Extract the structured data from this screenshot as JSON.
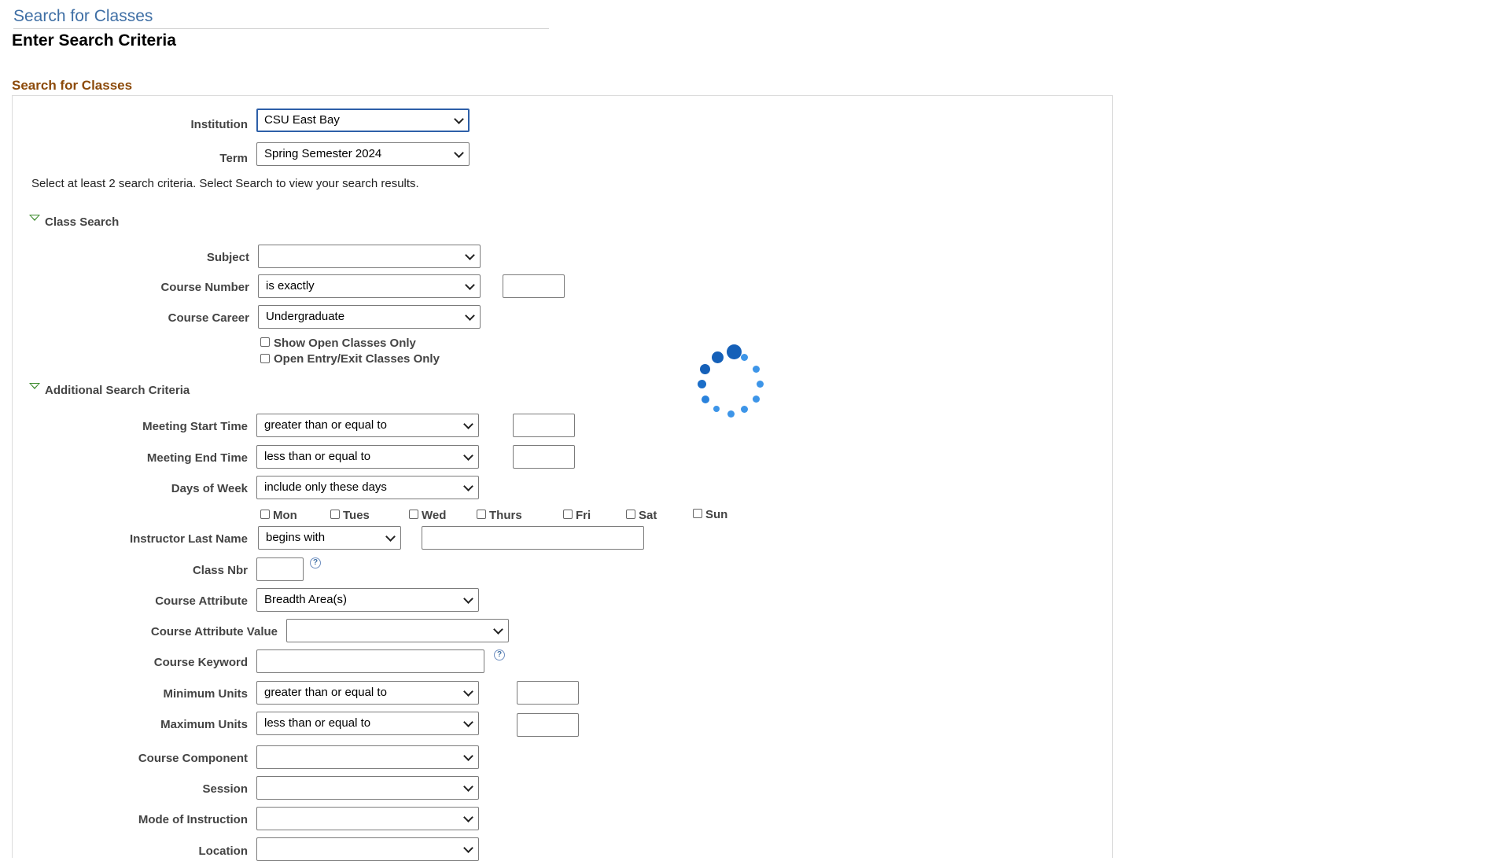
{
  "page": {
    "header": "Search for Classes",
    "subtitle": "Enter Search Criteria",
    "group_title": "Search for Classes"
  },
  "institution": {
    "label": "Institution",
    "value": "CSU East Bay"
  },
  "term": {
    "label": "Term",
    "value": "Spring Semester 2024"
  },
  "instructions": "Select at least 2 search criteria. Select Search to view your search results.",
  "class_search": {
    "title": "Class Search",
    "subject": {
      "label": "Subject",
      "value": ""
    },
    "course_number": {
      "label": "Course Number",
      "operator": "is exactly",
      "value": ""
    },
    "course_career": {
      "label": "Course Career",
      "value": "Undergraduate"
    },
    "open_classes_only": {
      "label": "Show Open Classes Only",
      "checked": false
    },
    "open_entry_exit_only": {
      "label": "Open Entry/Exit Classes Only",
      "checked": false
    }
  },
  "additional": {
    "title": "Additional Search Criteria",
    "meeting_start": {
      "label": "Meeting Start Time",
      "operator": "greater than or equal to",
      "value": ""
    },
    "meeting_end": {
      "label": "Meeting End Time",
      "operator": "less than or equal to",
      "value": ""
    },
    "days_of_week": {
      "label": "Days of Week",
      "operator": "include only these days",
      "days": [
        {
          "label": "Mon",
          "checked": false
        },
        {
          "label": "Tues",
          "checked": false
        },
        {
          "label": "Wed",
          "checked": false
        },
        {
          "label": "Thurs",
          "checked": false
        },
        {
          "label": "Fri",
          "checked": false
        },
        {
          "label": "Sat",
          "checked": false
        },
        {
          "label": "Sun",
          "checked": false
        }
      ]
    },
    "instructor_last_name": {
      "label": "Instructor Last Name",
      "operator": "begins with",
      "value": ""
    },
    "class_nbr": {
      "label": "Class Nbr",
      "value": ""
    },
    "course_attribute": {
      "label": "Course Attribute",
      "value": "Breadth Area(s)"
    },
    "course_attribute_value": {
      "label": "Course Attribute Value",
      "value": ""
    },
    "course_keyword": {
      "label": "Course Keyword",
      "value": ""
    },
    "minimum_units": {
      "label": "Minimum Units",
      "operator": "greater than or equal to",
      "value": ""
    },
    "maximum_units": {
      "label": "Maximum Units",
      "operator": "less than or equal to",
      "value": ""
    },
    "course_component": {
      "label": "Course Component",
      "value": ""
    },
    "session": {
      "label": "Session",
      "value": ""
    },
    "mode_of_instruction": {
      "label": "Mode of Instruction",
      "value": ""
    },
    "location": {
      "label": "Location",
      "value": ""
    }
  },
  "icons": {
    "help": "question-mark-icon",
    "section_toggle": "triangle-down-icon",
    "loading": "loading-spinner-icon"
  },
  "colors": {
    "header_text": "#3f6fa5",
    "group_title": "#8c4a0a",
    "spinner": "#1e6fc7",
    "toggle_triangle": "#3a8a2a"
  }
}
